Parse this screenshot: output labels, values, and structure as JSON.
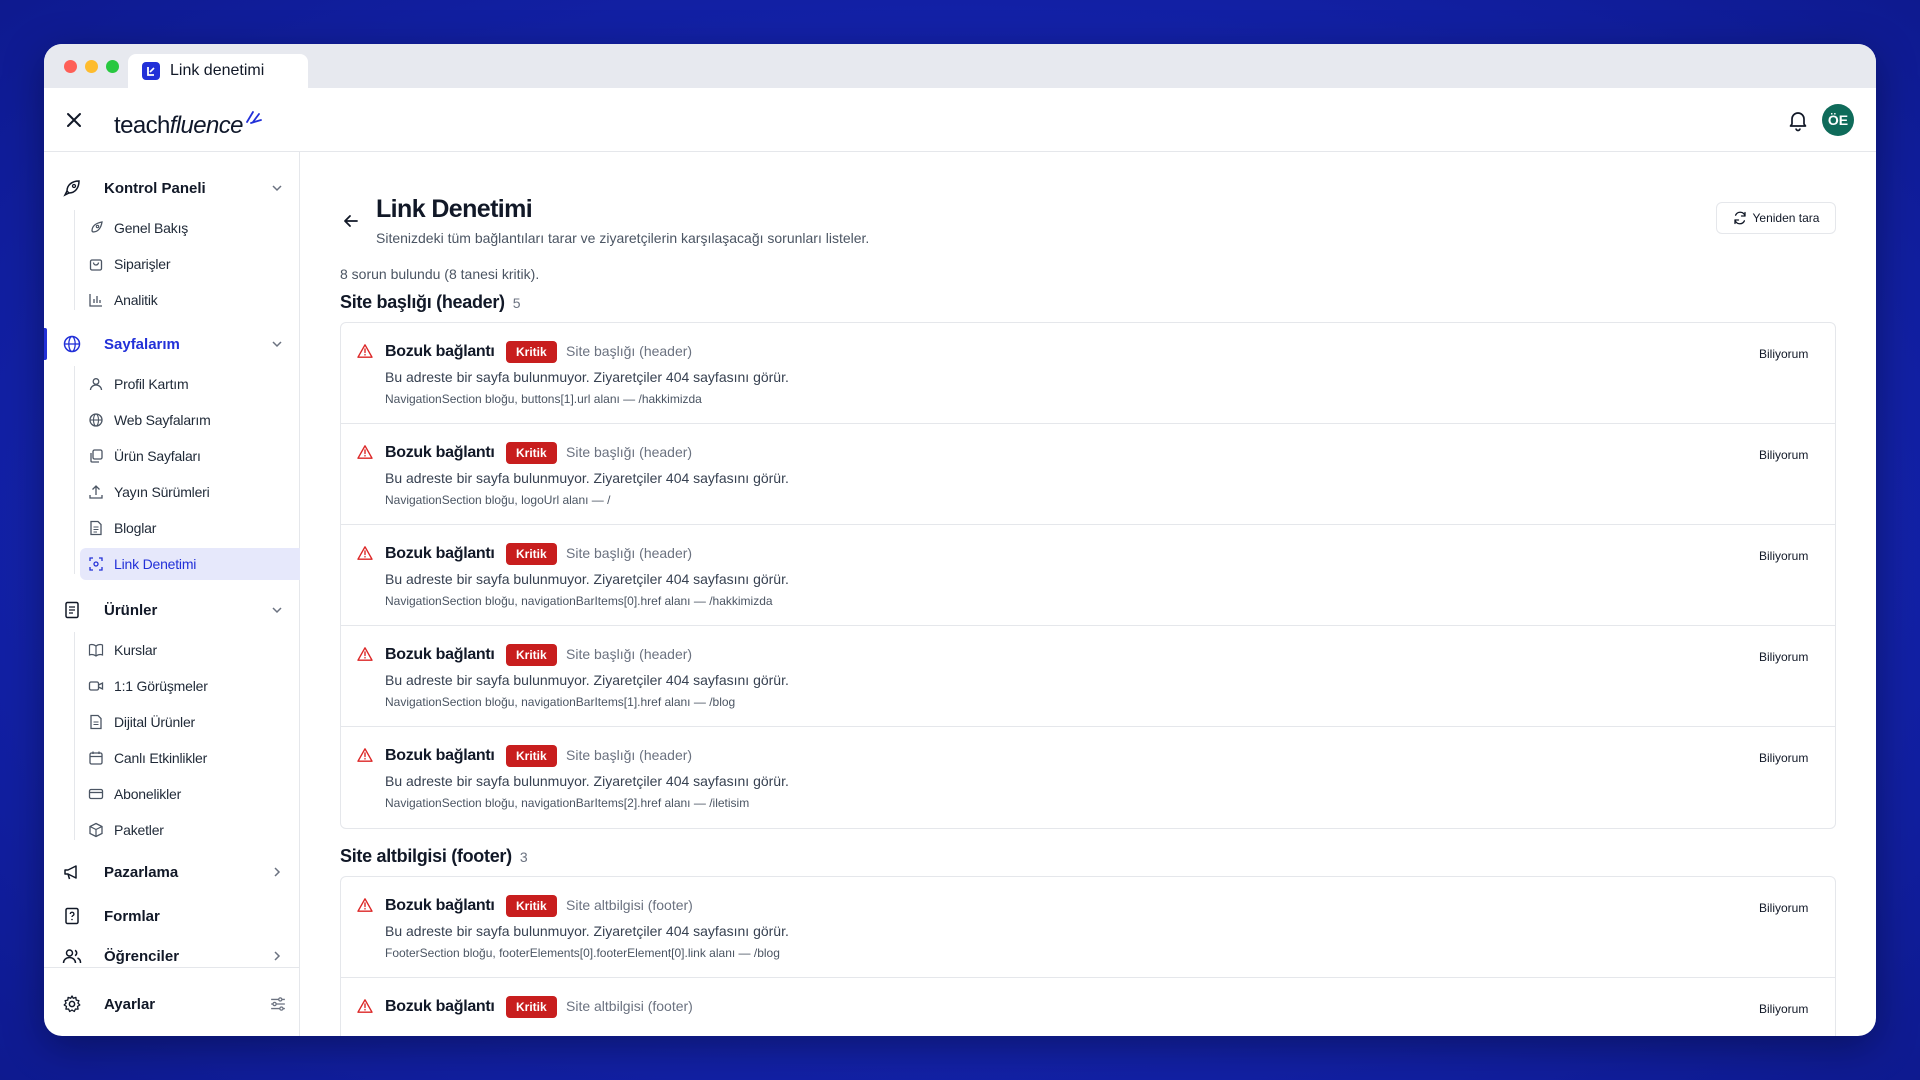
{
  "browser": {
    "tab_title": "Link denetimi"
  },
  "header": {
    "logo_teach": "teach",
    "logo_fluence": "fluence",
    "avatar_initials": "ÖE"
  },
  "colors": {
    "brand": "#2230d8",
    "critical": "#c81e1e",
    "avatar_bg": "#0f6b5a",
    "warning_icon": "#dc2626"
  },
  "sidebar": {
    "groups": [
      {
        "label": "Kontrol Paneli",
        "icon": "rocket-icon",
        "chevron": "down",
        "items": [
          {
            "label": "Genel Bakış",
            "icon": "rocket-icon"
          },
          {
            "label": "Siparişler",
            "icon": "shopping-bag-icon"
          },
          {
            "label": "Analitik",
            "icon": "bar-chart-icon"
          }
        ]
      },
      {
        "label": "Sayfalarım",
        "icon": "globe-icon",
        "chevron": "down",
        "active": true,
        "items": [
          {
            "label": "Profil Kartım",
            "icon": "user-icon"
          },
          {
            "label": "Web Sayfalarım",
            "icon": "globe-icon"
          },
          {
            "label": "Ürün Sayfaları",
            "icon": "copy-icon"
          },
          {
            "label": "Yayın Sürümleri",
            "icon": "upload-icon"
          },
          {
            "label": "Bloglar",
            "icon": "document-icon"
          },
          {
            "label": "Link Denetimi",
            "icon": "scan-icon",
            "active": true
          }
        ]
      },
      {
        "label": "Ürünler",
        "icon": "file-list-icon",
        "chevron": "down",
        "items": [
          {
            "label": "Kurslar",
            "icon": "book-icon"
          },
          {
            "label": "1:1 Görüşmeler",
            "icon": "video-icon"
          },
          {
            "label": "Dijital Ürünler",
            "icon": "file-icon"
          },
          {
            "label": "Canlı Etkinlikler",
            "icon": "calendar-icon"
          },
          {
            "label": "Abonelikler",
            "icon": "credit-card-icon"
          },
          {
            "label": "Paketler",
            "icon": "package-icon"
          }
        ]
      },
      {
        "label": "Pazarlama",
        "icon": "megaphone-icon",
        "chevron": "right"
      },
      {
        "label": "Formlar",
        "icon": "help-file-icon"
      },
      {
        "label": "Öğrenciler",
        "icon": "users-icon",
        "chevron": "right"
      }
    ],
    "settings": {
      "label": "Ayarlar",
      "icon": "gear-icon",
      "extra_icon": "sliders-icon"
    }
  },
  "main": {
    "title": "Link Denetimi",
    "subtitle": "Sitenizdeki tüm bağlantıları tarar ve ziyaretçilerin karşılaşacağı sorunları listeler.",
    "rescan_label": "Yeniden tara",
    "summary": "8 sorun bulundu (8 tanesi kritik).",
    "sections": [
      {
        "title": "Site başlığı (header)",
        "count": "5",
        "issues": [
          {
            "title": "Bozuk bağlantı",
            "badge": "Kritik",
            "location": "Site başlığı (header)",
            "description": "Bu adreste bir sayfa bulunmuyor. Ziyaretçiler 404 sayfasını görür.",
            "meta": "NavigationSection bloğu, buttons[1].url alanı — /hakkimizda",
            "action": "Biliyorum"
          },
          {
            "title": "Bozuk bağlantı",
            "badge": "Kritik",
            "location": "Site başlığı (header)",
            "description": "Bu adreste bir sayfa bulunmuyor. Ziyaretçiler 404 sayfasını görür.",
            "meta": "NavigationSection bloğu, logoUrl alanı — /",
            "action": "Biliyorum"
          },
          {
            "title": "Bozuk bağlantı",
            "badge": "Kritik",
            "location": "Site başlığı (header)",
            "description": "Bu adreste bir sayfa bulunmuyor. Ziyaretçiler 404 sayfasını görür.",
            "meta": "NavigationSection bloğu, navigationBarItems[0].href alanı — /hakkimizda",
            "action": "Biliyorum"
          },
          {
            "title": "Bozuk bağlantı",
            "badge": "Kritik",
            "location": "Site başlığı (header)",
            "description": "Bu adreste bir sayfa bulunmuyor. Ziyaretçiler 404 sayfasını görür.",
            "meta": "NavigationSection bloğu, navigationBarItems[1].href alanı — /blog",
            "action": "Biliyorum"
          },
          {
            "title": "Bozuk bağlantı",
            "badge": "Kritik",
            "location": "Site başlığı (header)",
            "description": "Bu adreste bir sayfa bulunmuyor. Ziyaretçiler 404 sayfasını görür.",
            "meta": "NavigationSection bloğu, navigationBarItems[2].href alanı — /iletisim",
            "action": "Biliyorum"
          }
        ]
      },
      {
        "title": "Site altbilgisi (footer)",
        "count": "3",
        "issues": [
          {
            "title": "Bozuk bağlantı",
            "badge": "Kritik",
            "location": "Site altbilgisi (footer)",
            "description": "Bu adreste bir sayfa bulunmuyor. Ziyaretçiler 404 sayfasını görür.",
            "meta": "FooterSection bloğu, footerElements[0].footerElement[0].link alanı — /blog",
            "action": "Biliyorum"
          },
          {
            "title": "Bozuk bağlantı",
            "badge": "Kritik",
            "location": "Site altbilgisi (footer)",
            "action": "Biliyorum"
          }
        ]
      }
    ]
  }
}
